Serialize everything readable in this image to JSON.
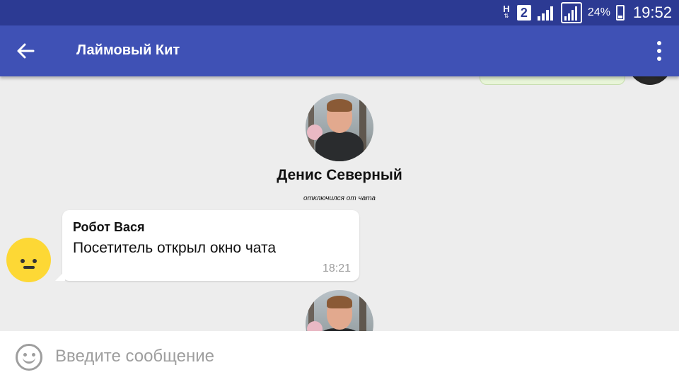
{
  "status_bar": {
    "network_type": "H",
    "sim_slot": "2",
    "battery_percent": "24%",
    "battery_level": 0.24,
    "time": "19:52"
  },
  "app_bar": {
    "title": "Лаймовый Кит",
    "back_icon": "arrow-left-icon",
    "menu_icon": "more-vertical-icon"
  },
  "chat": {
    "system_event": {
      "user_name": "Денис Северный",
      "status_text": "отключился от чата",
      "avatar": "user-photo-avatar"
    },
    "messages": [
      {
        "sender": "Робот Вася",
        "text": "Посетитель открыл окно чата",
        "time": "18:21",
        "avatar": "smiley-face-avatar"
      }
    ]
  },
  "composer": {
    "placeholder": "Введите сообщение",
    "value": "",
    "emoji_icon": "emoji-smile-icon"
  },
  "colors": {
    "status_bar": "#2c3a93",
    "app_bar": "#3f51b5",
    "chat_background": "#ededed",
    "bot_avatar": "#fdd835",
    "outgoing_bubble": "#e8f5d8"
  }
}
